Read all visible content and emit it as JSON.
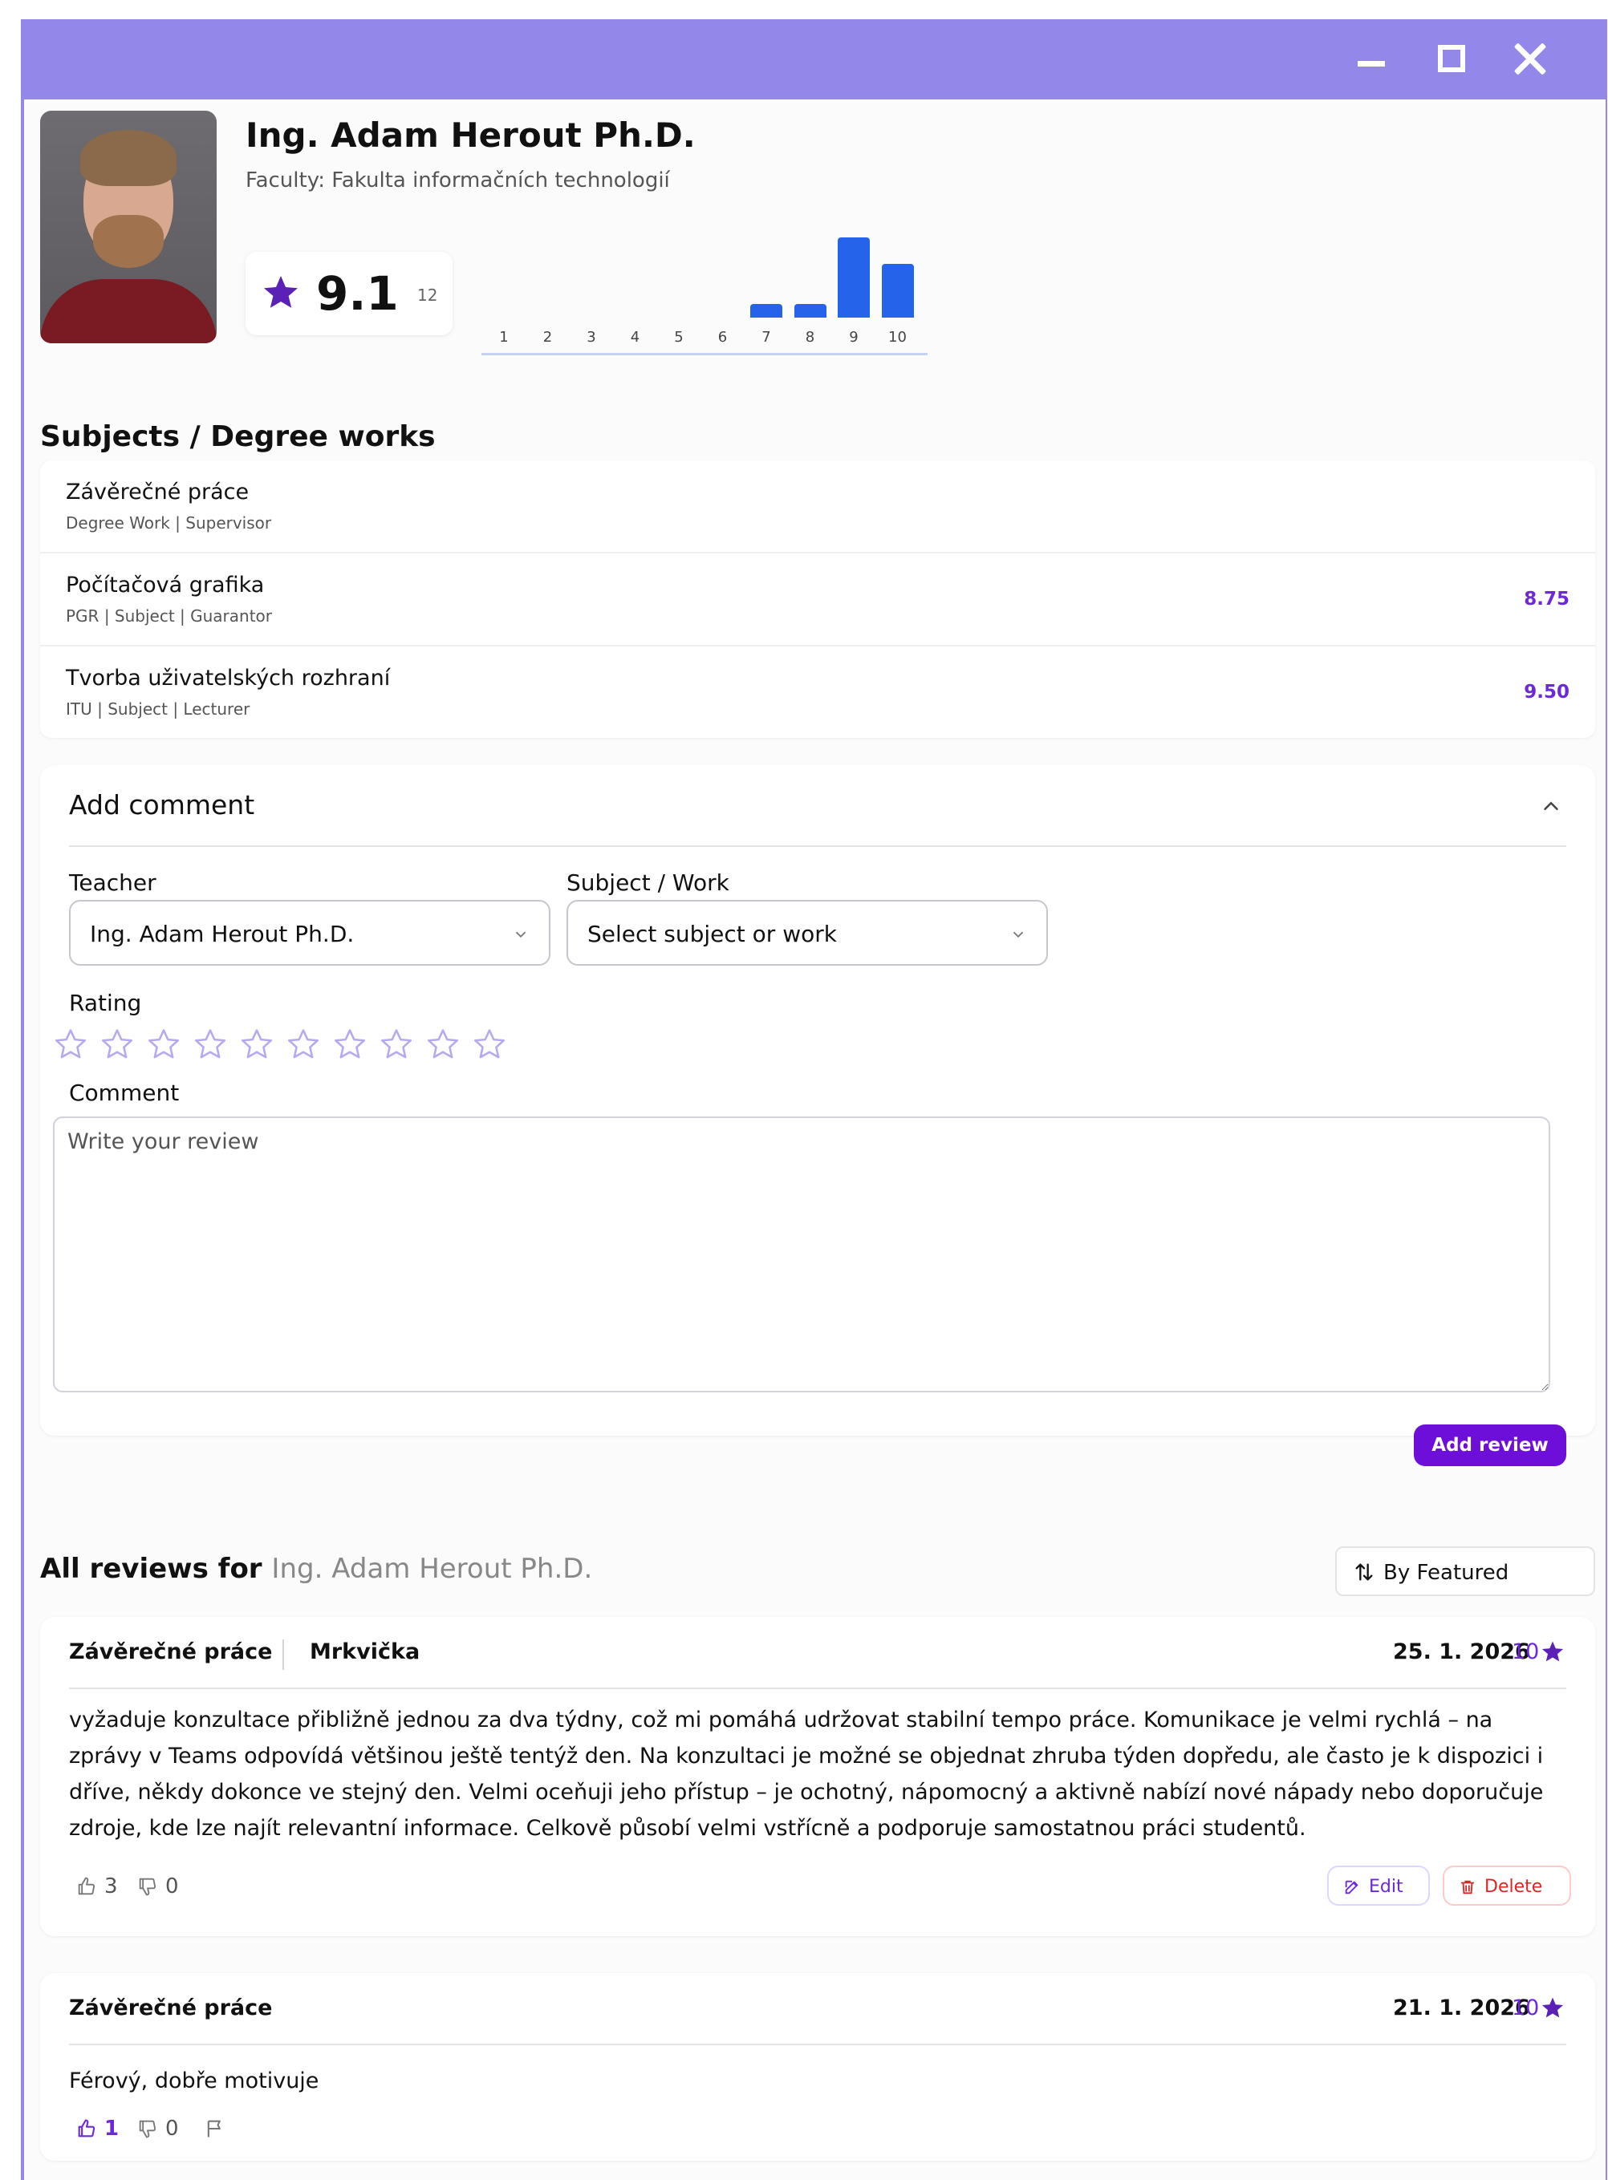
{
  "window": {
    "controls": [
      "minimize",
      "maximize",
      "close"
    ]
  },
  "profile": {
    "name": "Ing. Adam Herout Ph.D.",
    "faculty": "Faculty: Fakulta informačních technologií",
    "rating_avg": "9.1",
    "rating_count": "12"
  },
  "chart_data": {
    "type": "bar",
    "categories": [
      "1",
      "2",
      "3",
      "4",
      "5",
      "6",
      "7",
      "8",
      "9",
      "10"
    ],
    "values": [
      0,
      0,
      0,
      0,
      0,
      0,
      1,
      1,
      6,
      4
    ],
    "color": "#2563eb"
  },
  "subjects_section": {
    "title": "Subjects / Degree works",
    "items": [
      {
        "title": "Závěrečné práce",
        "meta": "Degree Work | Supervisor",
        "score": ""
      },
      {
        "title": "Počítačová grafika",
        "meta": "PGR | Subject | Guarantor",
        "score": "8.75"
      },
      {
        "title": "Tvorba uživatelských rozhraní",
        "meta": "ITU | Subject | Lecturer",
        "score": "9.50"
      }
    ]
  },
  "add_comment": {
    "title": "Add comment",
    "teacher_label": "Teacher",
    "teacher_value": "Ing. Adam Herout Ph.D.",
    "subject_label": "Subject / Work",
    "subject_value": "Select subject or work",
    "rating_label": "Rating",
    "rating_value": 0,
    "rating_max": 10,
    "comment_label": "Comment",
    "comment_placeholder": "Write your review",
    "submit_label": "Add review"
  },
  "reviews": {
    "title_prefix": "All reviews for",
    "title_teacher": "Ing. Adam Herout Ph.D.",
    "sort_label": "By Featured",
    "items": [
      {
        "subject": "Závěrečné práce",
        "author": "Mrkvička",
        "date": "25. 1. 2026",
        "score": "10",
        "text": "vyžaduje konzultace přibližně jednou za dva týdny, což mi pomáhá udržovat stabilní tempo práce. Komunikace je velmi rychlá – na zprávy v Teams odpovídá většinou ještě tentýž den. Na konzultaci je možné se objednat zhruba týden dopředu, ale často je k dispozici i dříve, někdy dokonce ve stejný den. Velmi oceňuji jeho přístup – je ochotný, nápomocný a aktivně nabízí nové nápady nebo doporučuje zdroje, kde lze najít relevantní informace. Celkově působí velmi vstřícně a podporuje samostatnou práci studentů.",
        "likes": "3",
        "dislikes": "0",
        "edit_label": "Edit",
        "delete_label": "Delete"
      },
      {
        "subject": "Závěrečné práce",
        "date": "21. 1. 2026",
        "score": "10",
        "text": "Férový, dobře motivuje",
        "likes": "1",
        "dislikes": "0"
      }
    ]
  },
  "colors": {
    "accent": "#6d28d9",
    "titlebar": "#9388ea",
    "chart_bar": "#2563eb",
    "delete": "#dc2626"
  }
}
